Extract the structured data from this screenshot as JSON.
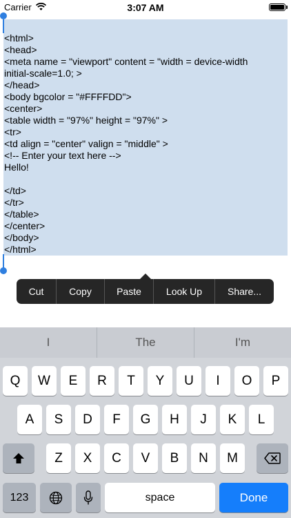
{
  "status_bar": {
    "carrier": "Carrier",
    "time": "3:07 AM"
  },
  "editor": {
    "text": "<html>\n<head>\n<meta name = \"viewport\" content = \"width = device-width\ninitial-scale=1.0; >\n</head>\n<body bgcolor = \"#FFFFDD\">\n<center>\n<table width = \"97%\" height = \"97%\" >\n<tr>\n<td align = \"center\" valign = \"middle\" >\n<!-- Enter your text here -->\nHello!\n\n</td>\n</tr>\n</table>\n</center>\n</body>\n</html>",
    "selection_color": "#cfdeee",
    "handle_color": "#2f7fe0"
  },
  "edit_menu": {
    "items": [
      "Cut",
      "Copy",
      "Paste",
      "Look Up",
      "Share..."
    ]
  },
  "keyboard": {
    "suggestions": [
      "I",
      "The",
      "I'm"
    ],
    "row1": [
      "Q",
      "W",
      "E",
      "R",
      "T",
      "Y",
      "U",
      "I",
      "O",
      "P"
    ],
    "row2": [
      "A",
      "S",
      "D",
      "F",
      "G",
      "H",
      "J",
      "K",
      "L"
    ],
    "row3": [
      "Z",
      "X",
      "C",
      "V",
      "B",
      "N",
      "M"
    ],
    "numbers_key": "123",
    "space_key": "space",
    "done_key": "Done",
    "accent_color": "#157efb"
  }
}
